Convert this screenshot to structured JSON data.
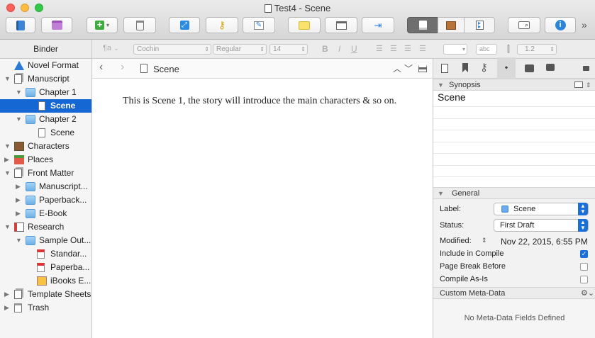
{
  "window": {
    "title": "Test4 - Scene"
  },
  "colors": {
    "accent": "#1567d3",
    "close": "#fc605c",
    "minimize": "#fdbc40",
    "zoom": "#34c84a"
  },
  "toolbar": {
    "icons": [
      "binder-icon",
      "collections-icon",
      "add-icon",
      "trash-icon",
      "fullscreen-icon",
      "keywords-icon",
      "edit-icon",
      "comment-icon",
      "layout-icon",
      "goto-icon",
      "editor-mode-icon",
      "corkboard-icon",
      "outliner-icon",
      "search-icon",
      "inspector-icon"
    ],
    "overflow": "»"
  },
  "formatbar": {
    "paragraph": "¶a",
    "font": "Cochin",
    "style": "Regular",
    "size": "14",
    "bold": "B",
    "italic": "I",
    "underline": "U",
    "abc": "abc",
    "line_spacing": "1.2"
  },
  "binder": {
    "header": "Binder",
    "items": [
      {
        "label": "Novel Format"
      },
      {
        "label": "Manuscript"
      },
      {
        "label": "Chapter 1"
      },
      {
        "label": "Scene"
      },
      {
        "label": "Chapter 2"
      },
      {
        "label": "Scene"
      },
      {
        "label": "Characters"
      },
      {
        "label": "Places"
      },
      {
        "label": "Front Matter"
      },
      {
        "label": "Manuscript..."
      },
      {
        "label": "Paperback..."
      },
      {
        "label": "E-Book"
      },
      {
        "label": "Research"
      },
      {
        "label": "Sample Out..."
      },
      {
        "label": "Standar..."
      },
      {
        "label": "Paperba..."
      },
      {
        "label": "iBooks E..."
      },
      {
        "label": "Template Sheets"
      },
      {
        "label": "Trash"
      }
    ]
  },
  "editor": {
    "header_title": "Scene",
    "body": "This is Scene 1, the story will introduce the main characters & so on."
  },
  "inspector": {
    "synopsis": {
      "header": "Synopsis",
      "text": "Scene"
    },
    "general": {
      "header": "General",
      "label_label": "Label:",
      "label_value": "Scene",
      "status_label": "Status:",
      "status_value": "First Draft",
      "modified_label": "Modified:",
      "modified_value": "Nov 22, 2015, 6:55 PM",
      "include_in_compile": "Include in Compile",
      "include_checked": true,
      "page_break_before": "Page Break Before",
      "page_break_checked": false,
      "compile_as_is": "Compile As-Is",
      "compile_as_is_checked": false
    },
    "meta": {
      "header": "Custom Meta-Data",
      "empty": "No Meta-Data Fields Defined"
    }
  }
}
